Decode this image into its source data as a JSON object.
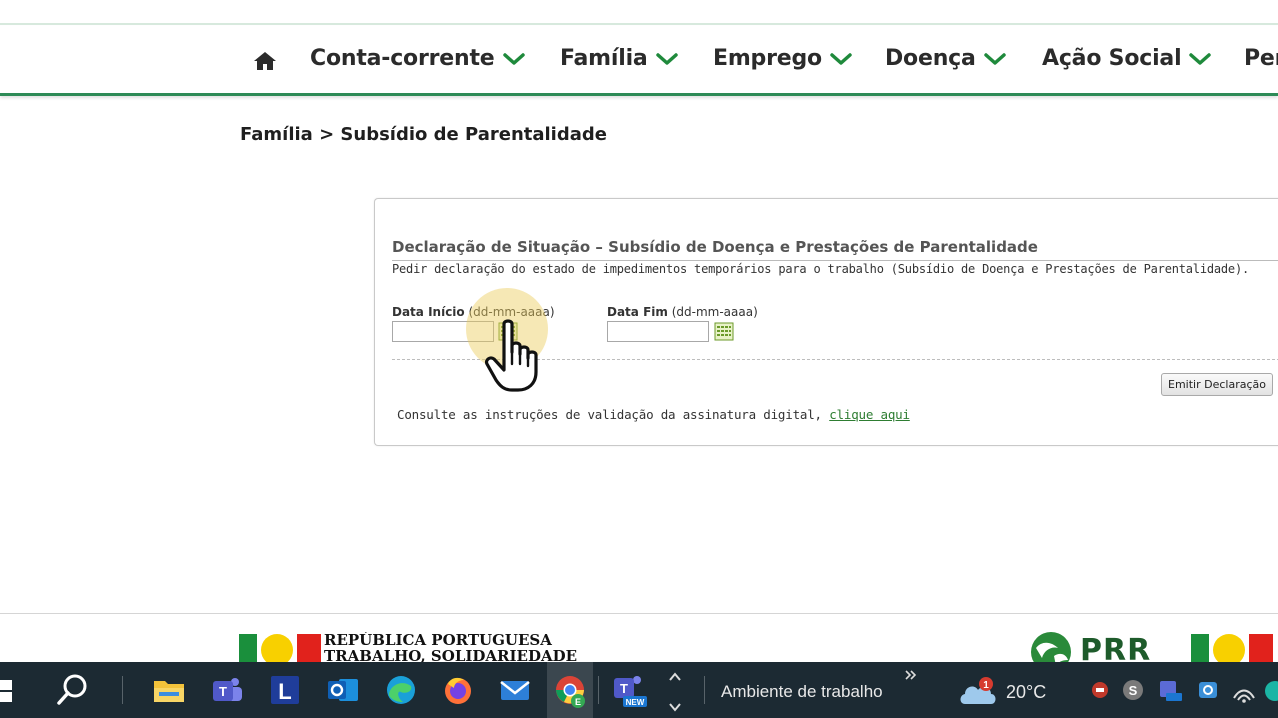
{
  "nav": {
    "items": [
      {
        "label": "Conta-corrente"
      },
      {
        "label": "Família"
      },
      {
        "label": "Emprego"
      },
      {
        "label": "Doença"
      },
      {
        "label": "Ação Social"
      },
      {
        "label": "Per"
      }
    ]
  },
  "breadcrumb": "Família > Subsídio de Parentalidade",
  "panel": {
    "title": "Declaração de Situação – Subsídio de Doença e Prestações de Parentalidade",
    "subtitle": "Pedir declaração do estado de impedimentos temporários para o trabalho (Subsídio de Doença e Prestações de Parentalidade).",
    "start": {
      "label": "Data Início",
      "format": "(dd-mm-aaaa)",
      "value": ""
    },
    "end": {
      "label": "Data Fim",
      "format": "(dd-mm-aaaa)",
      "value": ""
    },
    "emit_button": "Emitir Declaração",
    "validation_text": "Consulte as instruções de validação da assinatura digital,",
    "validation_link": "clique aqui"
  },
  "footer": {
    "republica_line1": "REPÚBLICA PORTUGUESA",
    "republica_line2": "TRABALHO, SOLIDARIEDADE",
    "prr": "PRR"
  },
  "taskbar": {
    "desktop_label": "Ambiente de trabalho",
    "weather": "20°C",
    "weather_badge": "1",
    "teams_badge": "NEW"
  },
  "colors": {
    "accent_green": "#2e8b57",
    "chevron_green": "#1f8a3c",
    "taskbar_bg": "#1c2a33"
  }
}
